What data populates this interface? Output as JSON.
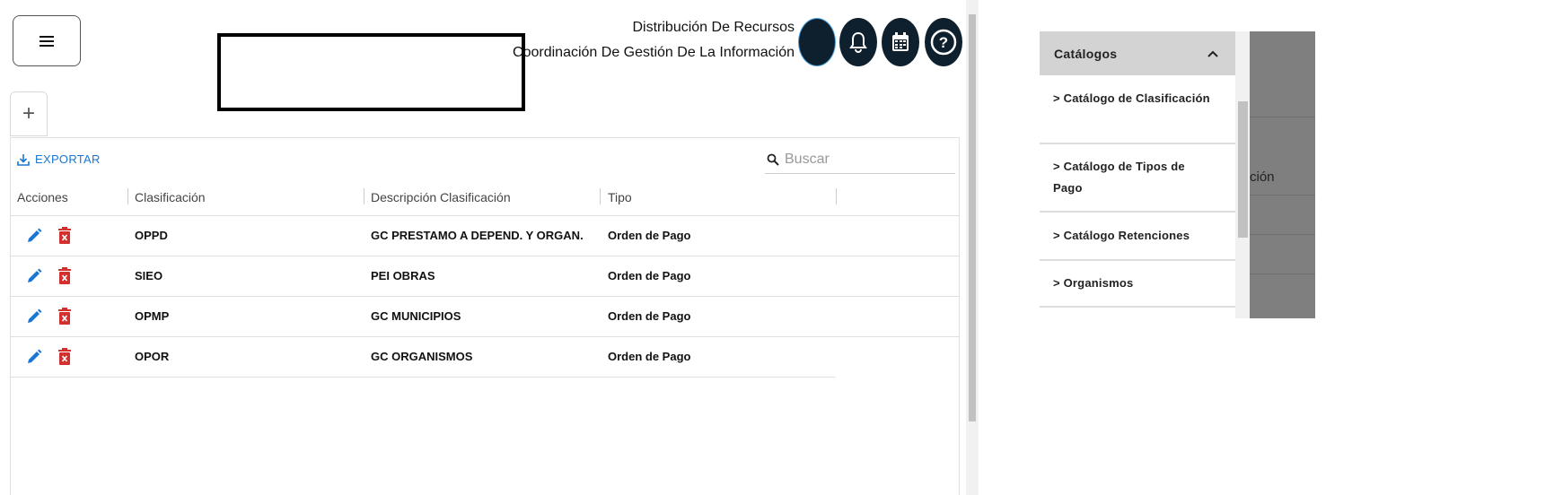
{
  "header": {
    "line1": "Distribución De Recursos",
    "line2": "Coordinación De Gestión De La Información"
  },
  "icons": {
    "menu": "hamburger-icon",
    "add": "+",
    "avatar": "user-avatar",
    "bell": "bell-icon",
    "calendar": "calendar-icon",
    "help": "?"
  },
  "toolbar": {
    "export_label": "EXPORTAR",
    "search_placeholder": "Buscar"
  },
  "table": {
    "columns": [
      "Acciones",
      "Clasificación",
      "Descripción Clasificación",
      "Tipo"
    ],
    "rows": [
      {
        "clasificacion": "OPPD",
        "descripcion": "GC PRESTAMO A DEPEND. Y ORGAN.",
        "tipo": "Orden de Pago"
      },
      {
        "clasificacion": "SIEO",
        "descripcion": "PEI OBRAS",
        "tipo": "Orden de Pago"
      },
      {
        "clasificacion": "OPMP",
        "descripcion": "GC MUNICIPIOS",
        "tipo": "Orden de Pago"
      },
      {
        "clasificacion": "OPOR",
        "descripcion": "GC ORGANISMOS",
        "tipo": "Orden de Pago"
      }
    ]
  },
  "drawer": {
    "title": "Catálogos",
    "items": [
      "> Catálogo de Clasificación",
      "> Catálogo de Tipos de Pago",
      "> Catálogo Retenciones",
      "> Organismos"
    ],
    "behind_text": "ción"
  },
  "colors": {
    "accent": "#1976d2",
    "delete": "#d32f2f",
    "icon_bg": "#0e1f2e",
    "drawer_header": "#d3d3d3"
  }
}
